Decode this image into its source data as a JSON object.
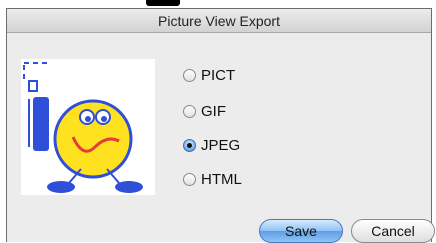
{
  "dialog": {
    "title": "Picture View Export"
  },
  "formats": [
    {
      "label": "PICT",
      "selected": false
    },
    {
      "label": "GIF",
      "selected": false
    },
    {
      "label": "JPEG",
      "selected": true
    },
    {
      "label": "HTML",
      "selected": false
    }
  ],
  "buttons": {
    "save_label": "Save",
    "cancel_label": "Cancel"
  },
  "icon": {
    "name": "picture-view-character-icon"
  },
  "colors": {
    "accent": "#5f9ee6",
    "face": "#ffe21f"
  }
}
